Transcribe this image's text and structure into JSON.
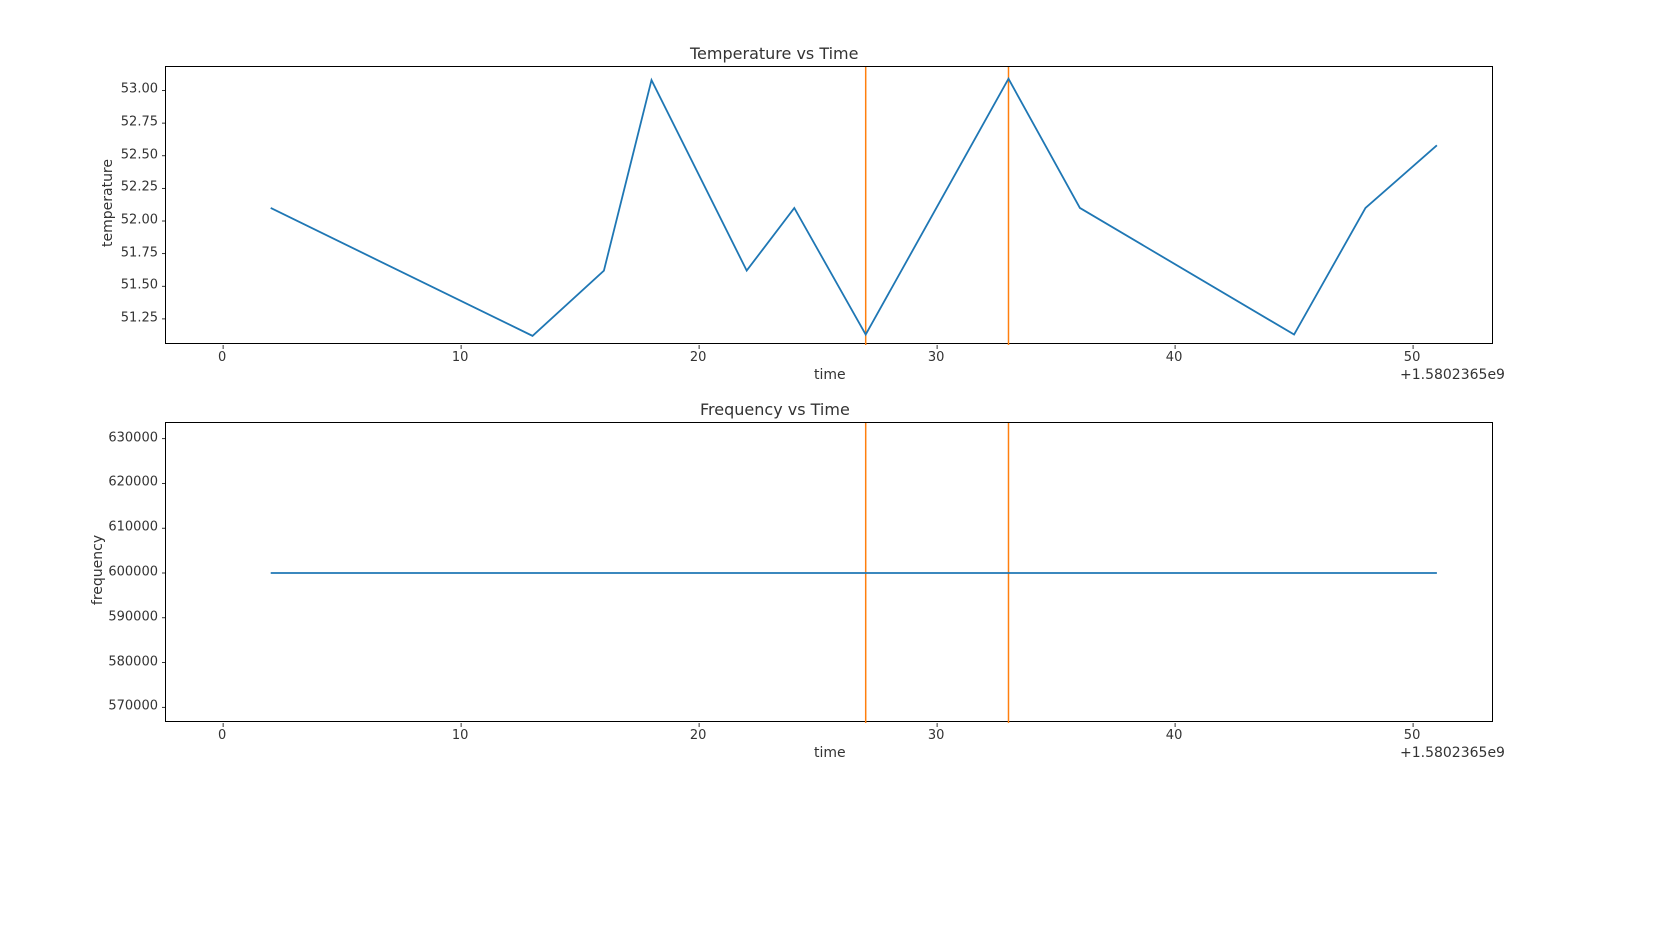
{
  "colors": {
    "line": "#1f77b4",
    "marker_line": "#ff7f0e",
    "axis": "#000000",
    "text": "#333333"
  },
  "chart_data": [
    {
      "type": "line",
      "title": "Temperature vs Time",
      "xlabel": "time",
      "ylabel": "temperature",
      "x_offset_label": "+1.5802365e9",
      "x_ticks": [
        0,
        10,
        20,
        30,
        40,
        50
      ],
      "y_ticks": [
        51.25,
        51.5,
        51.75,
        52.0,
        52.25,
        52.5,
        52.75,
        53.0
      ],
      "y_tick_labels": [
        "51.25",
        "51.50",
        "51.75",
        "52.00",
        "52.25",
        "52.50",
        "52.75",
        "53.00"
      ],
      "xlim": [
        -2.4,
        53.4
      ],
      "ylim": [
        51.05,
        53.18
      ],
      "x": [
        2,
        13,
        16,
        18,
        22,
        24,
        27,
        33,
        36,
        45,
        48,
        51
      ],
      "y": [
        52.1,
        51.12,
        51.62,
        53.08,
        51.62,
        52.1,
        51.13,
        53.09,
        52.1,
        51.13,
        52.1,
        52.58
      ],
      "vlines_x": [
        27,
        33
      ]
    },
    {
      "type": "line",
      "title": "Frequency vs Time",
      "xlabel": "time",
      "ylabel": "frequency",
      "x_offset_label": "+1.5802365e9",
      "x_ticks": [
        0,
        10,
        20,
        30,
        40,
        50
      ],
      "y_ticks": [
        570000,
        580000,
        590000,
        600000,
        610000,
        620000,
        630000
      ],
      "y_tick_labels": [
        "570000",
        "580000",
        "590000",
        "600000",
        "610000",
        "620000",
        "630000"
      ],
      "xlim": [
        -2.4,
        53.4
      ],
      "ylim": [
        566500,
        633500
      ],
      "x": [
        2,
        51
      ],
      "y": [
        600000,
        600000
      ],
      "vlines_x": [
        27,
        33
      ]
    }
  ]
}
